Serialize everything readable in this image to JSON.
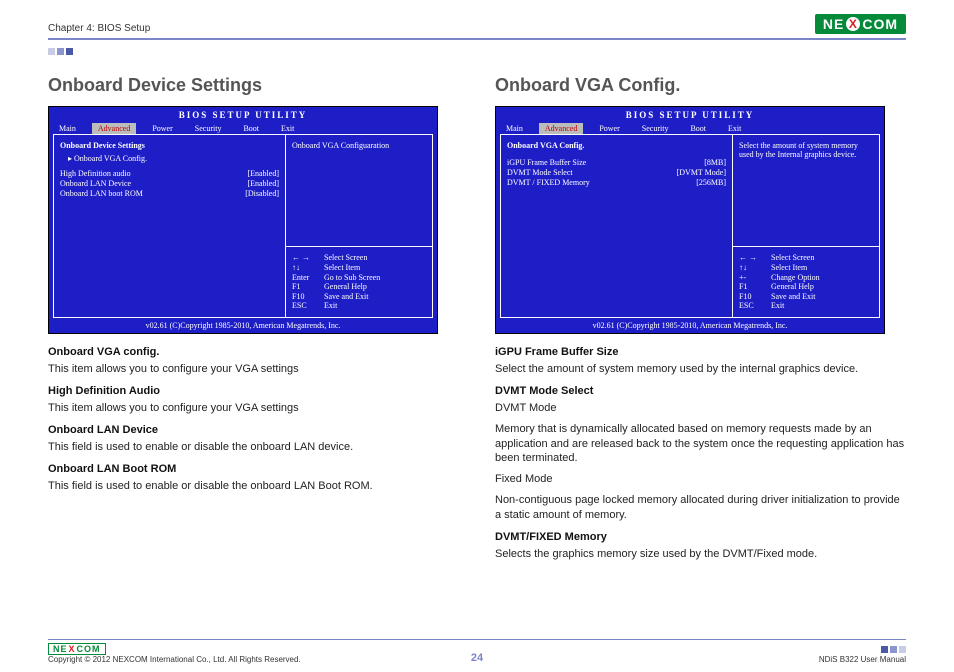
{
  "header": {
    "chapter": "Chapter 4: BIOS Setup",
    "logo_text_1": "NE",
    "logo_text_x": "X",
    "logo_text_2": "COM"
  },
  "left": {
    "title": "Onboard Device Settings",
    "bios": {
      "title": "BIOS  SETUP  UTILITY",
      "tabs": [
        "Main",
        "Advanced",
        "Power",
        "Security",
        "Boot",
        "Exit"
      ],
      "active_tab": 1,
      "section_head": "Onboard  Device  Settings",
      "subitem": "▸  Onboard  VGA  Config.",
      "rows": [
        {
          "label": "High  Definition  audio",
          "value": "[Enabled]"
        },
        {
          "label": "Onboard  LAN Device",
          "value": "[Enabled]"
        },
        {
          "label": "   Onboard  LAN  boot  ROM",
          "value": "[Disabled]"
        }
      ],
      "help_top": "Onboard VGA Configuaration",
      "nav": [
        {
          "key": "← →",
          "txt": "Select Screen"
        },
        {
          "key": "↑↓",
          "txt": "Select Item"
        },
        {
          "key": "Enter",
          "txt": "Go to Sub Screen"
        },
        {
          "key": "F1",
          "txt": "General Help"
        },
        {
          "key": "F10",
          "txt": "Save and Exit"
        },
        {
          "key": "ESC",
          "txt": "Exit"
        }
      ],
      "footer": "v02.61 (C)Copyright 1985-2010, American Megatrends, Inc."
    },
    "desc": [
      {
        "h": "Onboard VGA config.",
        "p": "This item allows you to configure your VGA settings"
      },
      {
        "h": "High Definition Audio",
        "p": "This item allows you to configure your VGA settings"
      },
      {
        "h": "Onboard LAN Device",
        "p": "This field is used to enable or disable the onboard LAN device."
      },
      {
        "h": "Onboard LAN Boot ROM",
        "p": "This field is used to enable or disable the onboard LAN Boot ROM."
      }
    ]
  },
  "right": {
    "title": "Onboard VGA Config.",
    "bios": {
      "title": "BIOS  SETUP  UTILITY",
      "tabs": [
        "Main",
        "Advanced",
        "Power",
        "Security",
        "Boot",
        "Exit"
      ],
      "active_tab": 1,
      "section_head": "Onboard  VGA  Config.",
      "rows": [
        {
          "label": "iGPU  Frame  Buffer  Size",
          "value": "[8MB]"
        },
        {
          "label": "DVMT  Mode  Select",
          "value": "[DVMT  Mode]"
        },
        {
          "label": "   DVMT / FIXED  Memory",
          "value": "[256MB]"
        }
      ],
      "help_top": "Select the amount of system memory used by the Internal graphics device.",
      "nav": [
        {
          "key": "← →",
          "txt": "Select Screen"
        },
        {
          "key": "↑↓",
          "txt": "Select Item"
        },
        {
          "key": "+-",
          "txt": "Change Option"
        },
        {
          "key": "F1",
          "txt": "General Help"
        },
        {
          "key": "F10",
          "txt": "Save and Exit"
        },
        {
          "key": "ESC",
          "txt": "Exit"
        }
      ],
      "footer": "v02.61 (C)Copyright 1985-2010, American Megatrends, Inc."
    },
    "desc": [
      {
        "h": "iGPU Frame Buffer Size",
        "p": "Select the amount of system memory used by the internal graphics device."
      },
      {
        "h": "DVMT Mode Select",
        "p": "DVMT Mode"
      },
      {
        "h": "",
        "p": "Memory that is dynamically allocated based on memory requests made by an application and are released back to the system once the requesting application has been terminated."
      },
      {
        "h": "",
        "p": "Fixed Mode"
      },
      {
        "h": "",
        "p": "Non-contiguous page locked memory allocated during driver initialization to provide a static amount of memory."
      },
      {
        "h": "DVMT/FIXED Memory",
        "p": "Selects the graphics memory size used by the DVMT/Fixed mode."
      }
    ]
  },
  "footer": {
    "copyright": "Copyright © 2012 NEXCOM International Co., Ltd. All Rights Reserved.",
    "page": "24",
    "manual": "NDiS B322 User Manual"
  }
}
